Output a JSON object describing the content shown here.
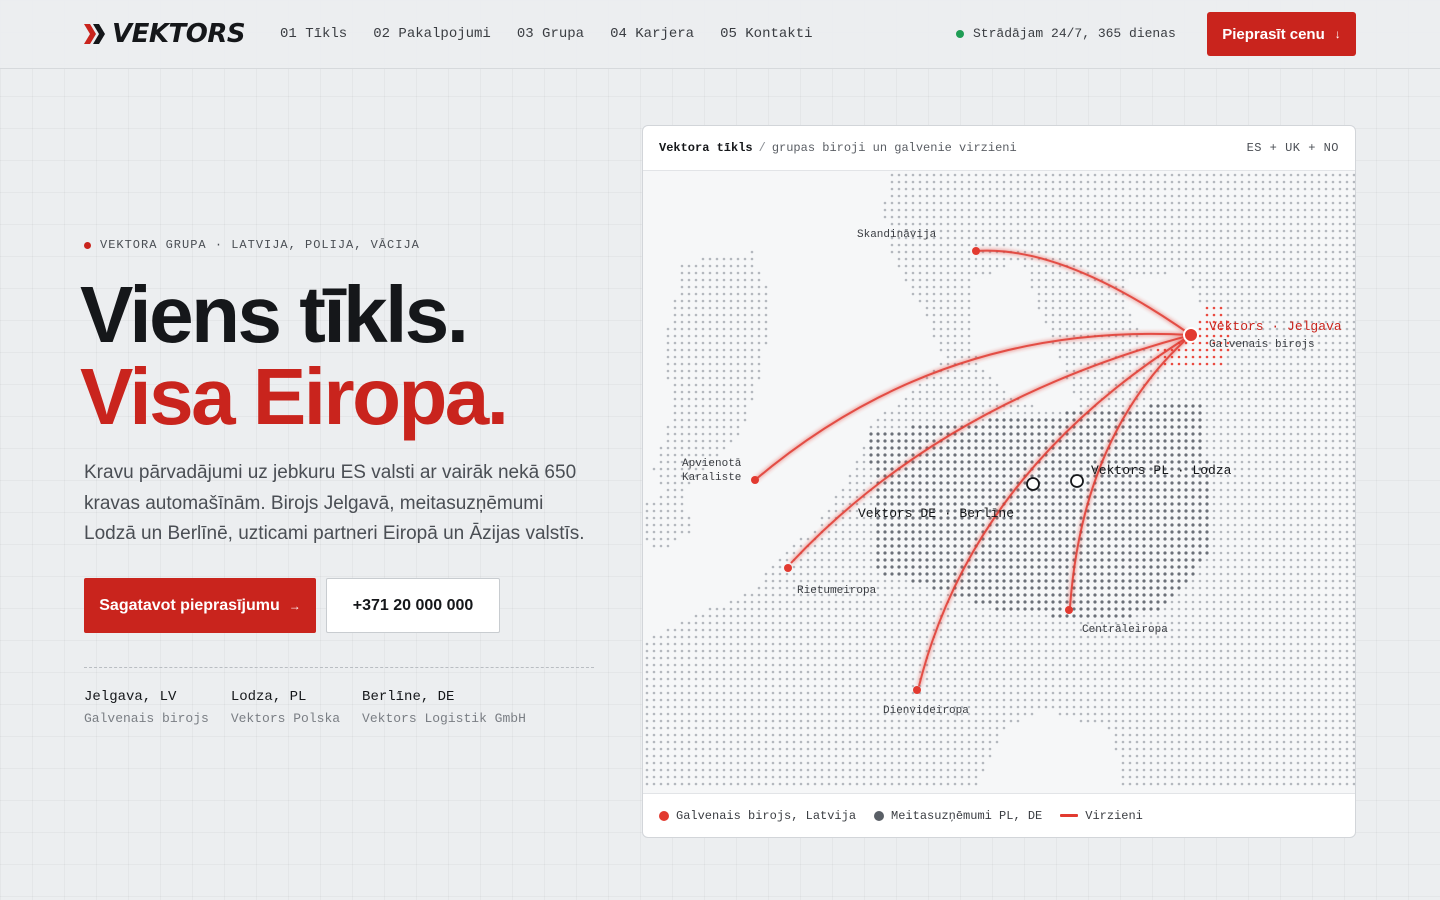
{
  "brand": {
    "name": "VEKTORS"
  },
  "nav": {
    "items": [
      {
        "label": "01 Tīkls"
      },
      {
        "label": "02 Pakalpojumi"
      },
      {
        "label": "03 Grupa"
      },
      {
        "label": "04 Karjera"
      },
      {
        "label": "05 Kontakti"
      }
    ]
  },
  "header": {
    "status": "Strādājam 24/7, 365 dienas",
    "cta_label": "Pieprasīt cenu",
    "cta_arrow": "↓"
  },
  "hero": {
    "eyebrow": "VEKTORA GRUPA · LATVIJA, POLIJA, VĀCIJA",
    "title_line1": "Viens tīkls.",
    "title_line2": "Visa Eiropa.",
    "lede": "Kravu pārvadājumi uz jebkuru ES valsti ar vairāk nekā 650 kravas automašīnām. Birojs Jelgavā, meitasuzņēmumi Lodzā un Berlīnē, uzticami partneri Eiropā un Āzijas valstīs.",
    "primary_button": "Sagatavot pieprasījumu",
    "primary_arrow": "→",
    "secondary_button": "+371 20 000 000",
    "offices": [
      {
        "city": "Jelgava, LV",
        "role": "Galvenais birojs"
      },
      {
        "city": "Lodza, PL",
        "role": "Vektors Polska"
      },
      {
        "city": "Berlīne, DE",
        "role": "Vektors Logistik GmbH"
      }
    ]
  },
  "map_card": {
    "title": "Vektora tīkls",
    "separator": "/",
    "subtitle": "grupas biroji un galvenie virzieni",
    "region_tag": "ES + UK + NO",
    "hq": {
      "name": "Vektors · Jelgava",
      "sub": "Galvenais birojs"
    },
    "subsidiaries": [
      {
        "name": "Vektors DE · Berlīne"
      },
      {
        "name": "Vektors PL · Lodza"
      }
    ],
    "routes": [
      {
        "label": "Skandināvija"
      },
      {
        "label_line1": "Apvienotā",
        "label_line2": "Karaliste"
      },
      {
        "label": "Rietumeiropa"
      },
      {
        "label": "Dienvideiropa"
      },
      {
        "label": "Centrāleiropa"
      }
    ],
    "legend": [
      {
        "label": "Galvenais birojs, Latvija",
        "color": "#e23a30"
      },
      {
        "label": "Meitasuzņēmumi PL, DE",
        "color": "#5a5f66"
      },
      {
        "label": "Virzieni",
        "color": "#e23a30"
      }
    ]
  },
  "colors": {
    "accent": "#c9241d",
    "route": "#e23a30",
    "status_online": "#1f9d55"
  }
}
